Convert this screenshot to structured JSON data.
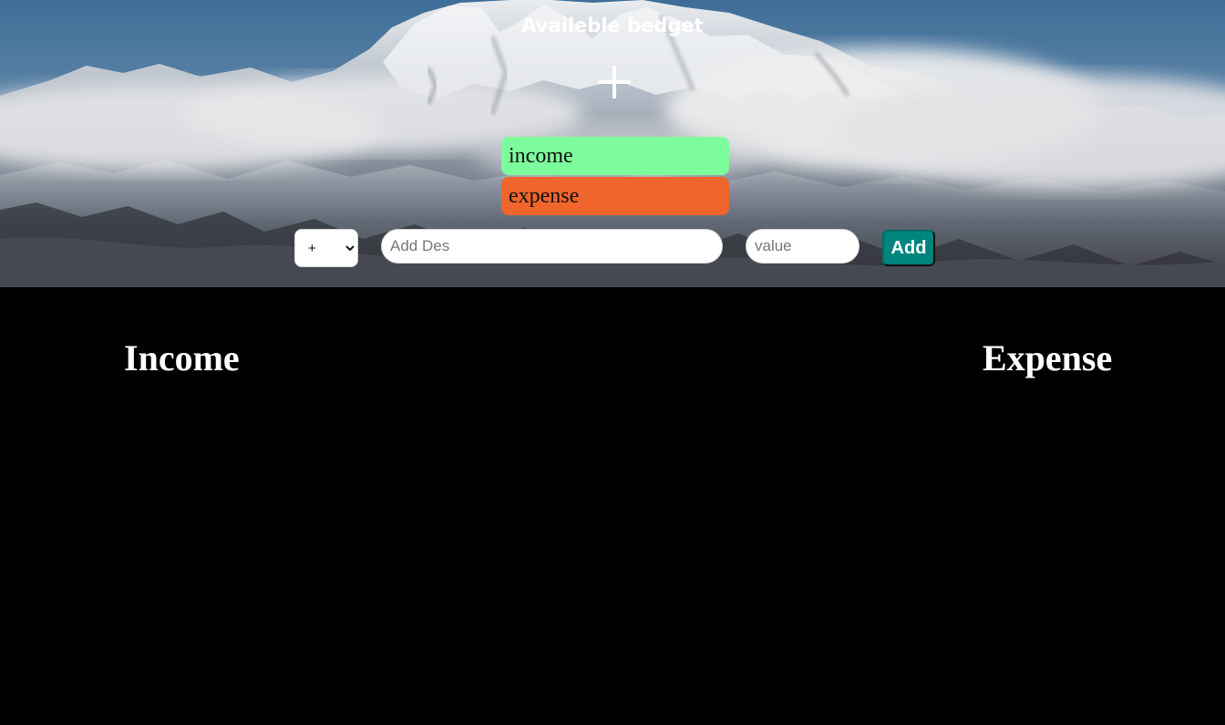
{
  "header": {
    "title": "Availeble bedget",
    "summary_icon": "plus-icon"
  },
  "summary": {
    "income_label": "income",
    "expense_label": "expense",
    "income_color": "#7dfc9d",
    "expense_color": "#f0652b"
  },
  "form": {
    "type_value": "+",
    "description_placeholder": "Add Des",
    "value_placeholder": "value",
    "add_label": "Add",
    "add_color": "#00847e"
  },
  "lists": {
    "income_title": "Income",
    "expense_title": "Expense"
  }
}
